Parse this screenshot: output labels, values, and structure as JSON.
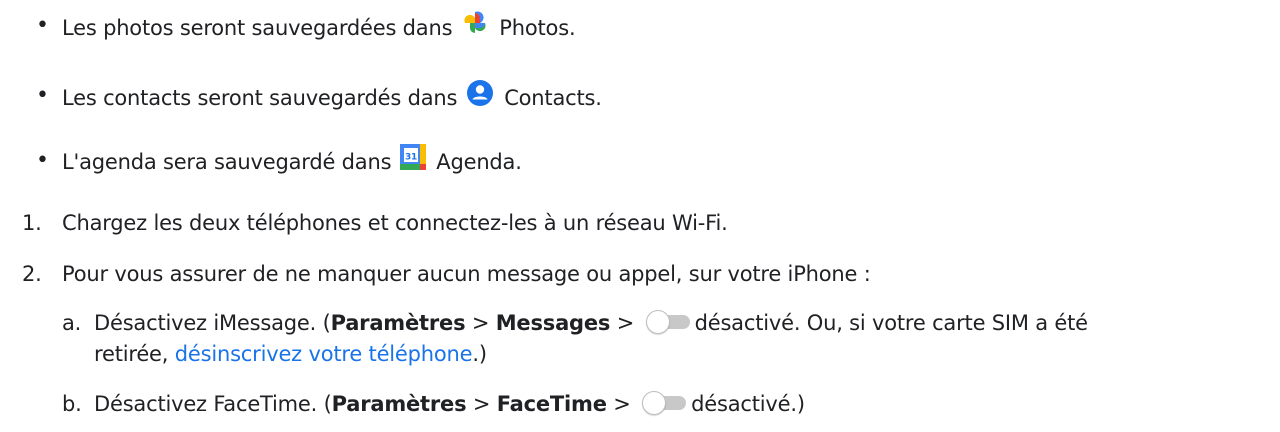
{
  "bullets": [
    {
      "marker": "•",
      "before": "Les photos seront sauvegardées dans",
      "icon": "google-photos-icon",
      "after": "Photos."
    },
    {
      "marker": "•",
      "before": "Les contacts seront sauvegardés dans",
      "icon": "google-contacts-icon",
      "after": "Contacts."
    },
    {
      "marker": "•",
      "before": "L'agenda sera sauvegardé dans",
      "icon": "google-calendar-icon",
      "icon_text": "31",
      "after": "Agenda."
    }
  ],
  "steps": [
    {
      "marker": "1.",
      "text": "Chargez les deux téléphones et connectez-les à un réseau Wi-Fi."
    },
    {
      "marker": "2.",
      "text": "Pour vous assurer de ne manquer aucun message ou appel, sur votre iPhone :"
    }
  ],
  "substeps": {
    "a": {
      "marker": "a.",
      "part1": "Désactivez iMessage. (",
      "bold1": "Paramètres",
      "sep1": " > ",
      "bold2": "Messages",
      "sep2": " > ",
      "after_toggle": "désactivé. Ou, si votre carte SIM a été",
      "line2_before": "retirée, ",
      "link": "désinscrivez votre téléphone",
      "line2_after": ".)"
    },
    "b": {
      "marker": "b.",
      "part1": "Désactivez FaceTime. (",
      "bold1": "Paramètres",
      "sep1": " > ",
      "bold2": "FaceTime",
      "sep2": " > ",
      "after_toggle": "désactivé.)"
    }
  },
  "colors": {
    "text": "#202124",
    "link": "#1a73e8"
  }
}
